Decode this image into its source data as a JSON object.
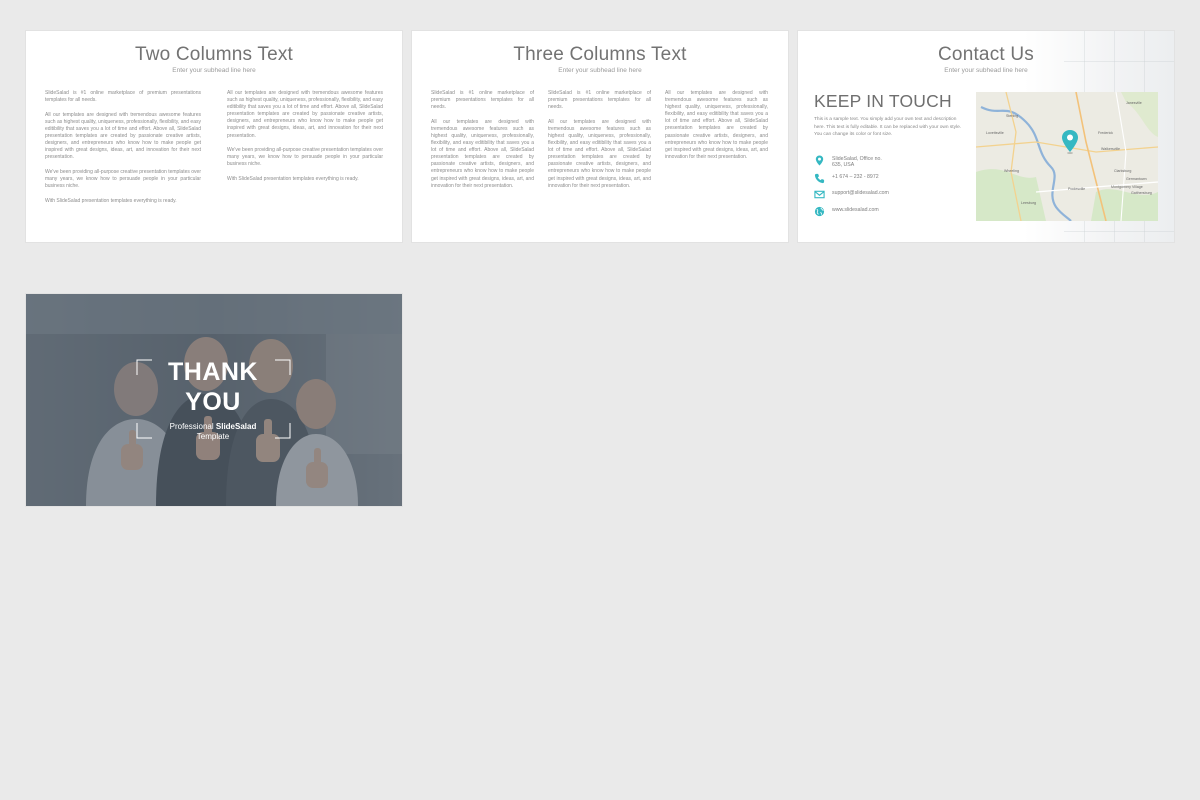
{
  "slides": {
    "two_columns": {
      "title": "Two Columns Text",
      "subtitle": "Enter your subhead line here",
      "col1": [
        "SlideSalad is #1 online marketplace of premium presentations templates for all needs.",
        "All our templates are designed with tremendous awesome features such as highest quality, uniqueness, professionally, flexibility, and easy editibility that saves you a lot of time and effort. Above all, SlideSalad presentation templates are created by passionate creative artists, designers, and entrepreneurs who know how to make people get inspired with great designs, ideas, art, and innovation for their next presentation.",
        "We've been providing all-purpose creative presentation templates over many years, we know how to persuade people in your particular business niche.",
        "With SlideSalad presentation templates everything is ready."
      ],
      "col2": [
        "All our templates are designed with tremendous awesome features such as highest quality, uniqueness, professionally, flexibility, and easy editibility that saves you a lot of time and effort. Above all, SlideSalad presentation templates are created by passionate creative artists, designers, and entrepreneurs who know how to make people get inspired with great designs, ideas, art, and innovation for their next presentation.",
        "We've been providing all-purpose creative presentation templates over many years, we know how to persuade people in your particular business niche.",
        "With SlideSalad presentation templates everything is ready."
      ]
    },
    "three_columns": {
      "title": "Three Columns Text",
      "subtitle": "Enter your subhead line here",
      "col1": [
        "SlideSalad is #1 online marketplace of premium presentations templates for all needs.",
        "All our templates are designed with tremendous awesome features such as highest quality, uniqueness, professionally, flexibility, and easy editibility that saves you a lot of time and effort. Above all, SlideSalad presentation templates are created by passionate creative artists, designers, and entrepreneurs who know how to make people get inspired with great designs, ideas, art, and innovation for their next presentation."
      ],
      "col2": [
        "SlideSalad is #1 online marketplace of premium presentations templates for all needs.",
        "All our templates are designed with tremendous awesome features such as highest quality, uniqueness, professionally, flexibility, and easy editibility that saves you a lot of time and effort. Above all, SlideSalad presentation templates are created by passionate creative artists, designers, and entrepreneurs who know how to make people get inspired with great designs, ideas, art, and innovation for their next presentation."
      ],
      "col3": [
        "All our templates are designed with tremendous awesome features such as highest quality, uniqueness, professionally, flexibility, and easy editibility that saves you a lot of time and effort. Above all, SlideSalad presentation templates are created by passionate creative artists, designers, and entrepreneurs who know how to make people get inspired with great designs, ideas, art, and innovation for their next presentation."
      ]
    },
    "contact": {
      "title": "Contact Us",
      "subtitle": "Enter your subhead line here",
      "heading": "KEEP IN TOUCH",
      "description": "This is a sample text. You simply add your own text and description here. This text is fully editable. It can be replaced with your own style. You can change its color or font size.",
      "address_line1": "SlideSalad, Office no.",
      "address_line2": "635, USA",
      "phone": "+1 674 – 232 - 8972",
      "email": "support@slidesalad.com",
      "website": "www.slidesalad.com",
      "accent_color": "#35b8c2",
      "map_labels": [
        "Janesville",
        "Sterling",
        "Lovettsville",
        "Wheeling",
        "Frederick",
        "Walkersville",
        "Leesburg",
        "Poolesville",
        "Clarksburg",
        "Germantown",
        "Montgomery Village",
        "Gaithersburg"
      ]
    },
    "thank_you": {
      "line1": "THANK",
      "line2": "YOU",
      "tagline_prefix": "Professional",
      "tagline_brand": "SlideSalad",
      "tagline_suffix": "Template"
    }
  }
}
